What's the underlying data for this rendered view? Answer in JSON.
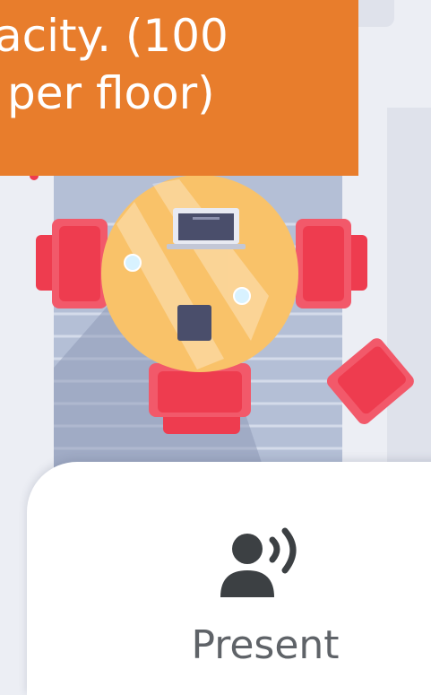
{
  "banner": {
    "line1": "acity. (100",
    "line2": "per floor)"
  },
  "present_button": {
    "label": "Present",
    "icon": "present-voice-icon"
  },
  "colors": {
    "banner_bg": "#e87d2c",
    "table": "#f9c269",
    "chair": "#ee3c4f",
    "floor": "#b4bfd6",
    "laptop": "#4a4e6b"
  }
}
